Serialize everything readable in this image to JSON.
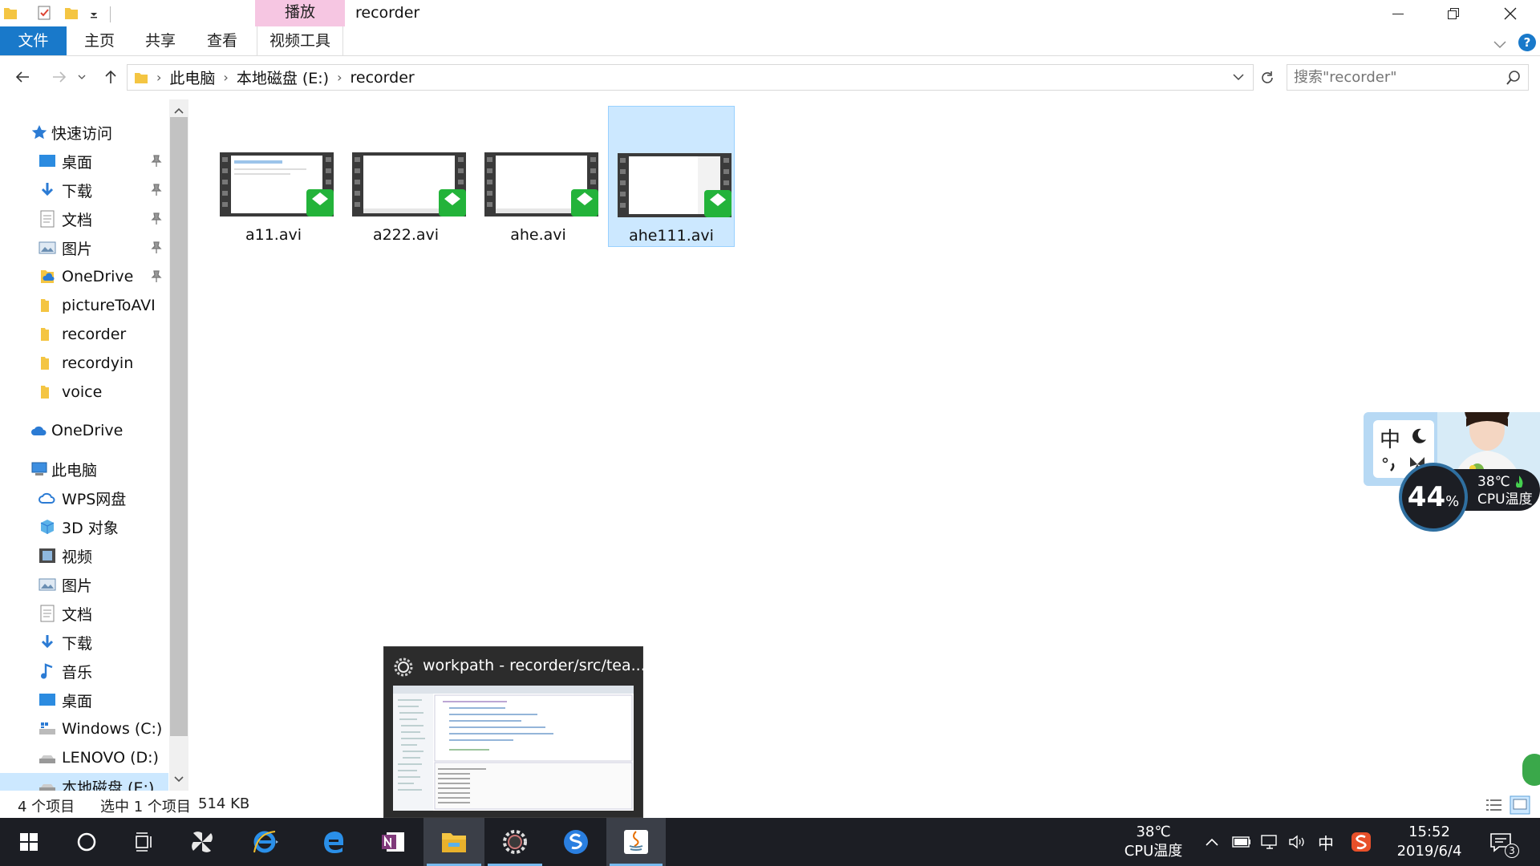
{
  "window": {
    "title": "recorder",
    "context_tab": "播放",
    "help": "?"
  },
  "ribbon": {
    "tabs": {
      "file": "文件",
      "home": "主页",
      "share": "共享",
      "view": "查看",
      "video_tools": "视频工具"
    }
  },
  "address": {
    "crumbs": [
      "此电脑",
      "本地磁盘 (E:)",
      "recorder"
    ]
  },
  "search": {
    "placeholder": "搜索\"recorder\""
  },
  "navpane": {
    "quick_access": "快速访问",
    "items": [
      {
        "label": "桌面",
        "pinned": true
      },
      {
        "label": "下载",
        "pinned": true
      },
      {
        "label": "文档",
        "pinned": true
      },
      {
        "label": "图片",
        "pinned": true
      },
      {
        "label": "OneDrive",
        "pinned": true
      },
      {
        "label": "pictureToAVI",
        "pinned": false
      },
      {
        "label": "recorder",
        "pinned": false
      },
      {
        "label": "recordyin",
        "pinned": false
      },
      {
        "label": "voice",
        "pinned": false
      }
    ],
    "onedrive": "OneDrive",
    "this_pc": "此电脑",
    "pc_items": [
      "WPS网盘",
      "3D 对象",
      "视频",
      "图片",
      "文档",
      "下载",
      "音乐",
      "桌面",
      "Windows (C:)",
      "LENOVO (D:)",
      "本地磁盘 (E:)"
    ]
  },
  "files": [
    {
      "name": "a11.avi",
      "selected": false
    },
    {
      "name": "a222.avi",
      "selected": false
    },
    {
      "name": "ahe.avi",
      "selected": false
    },
    {
      "name": "ahe111.avi",
      "selected": true
    }
  ],
  "status": {
    "count": "4 个项目",
    "selection": "选中 1 个项目",
    "size": "514 KB"
  },
  "preview": {
    "title": "workpath - recorder/src/tea..."
  },
  "tray": {
    "temp": "38℃",
    "temp_label": "CPU温度",
    "ime": "中",
    "time": "15:52",
    "date": "2019/6/4",
    "notifications": "3"
  },
  "widget": {
    "ime_char": "中",
    "cpu_percent": "44",
    "cpu_unit": "%",
    "cpu_temp": "38℃",
    "cpu_temp_label": "CPU温度"
  },
  "colors": {
    "accent": "#1979ca",
    "selection": "#cce8ff",
    "context_tab": "#f6c6e2",
    "taskbar": "#1c1e24"
  }
}
